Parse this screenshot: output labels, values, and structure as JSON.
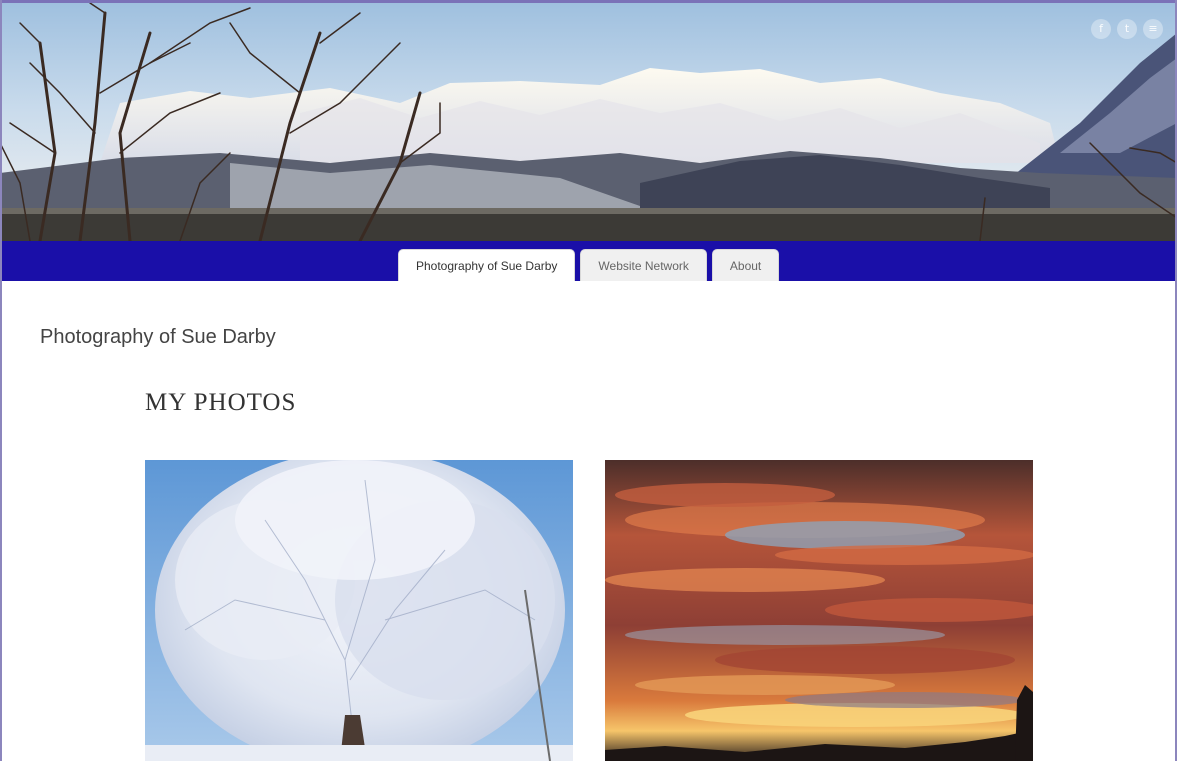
{
  "header": {
    "banner_alt": "",
    "social": [
      {
        "icon": "facebook-icon",
        "glyph": "f"
      },
      {
        "icon": "twitter-icon",
        "glyph": "t"
      },
      {
        "icon": "rss-icon",
        "glyph": "≡"
      }
    ]
  },
  "nav": {
    "tabs": [
      {
        "label": "Photography of Sue Darby",
        "active": true
      },
      {
        "label": "Website Network",
        "active": false
      },
      {
        "label": "About",
        "active": false
      }
    ]
  },
  "main": {
    "site_title": "Photography of Sue Darby",
    "section_heading": "MY PHOTOS"
  },
  "colors": {
    "nav_bar": "#1a0fa8",
    "frame": "#8c86bd"
  }
}
